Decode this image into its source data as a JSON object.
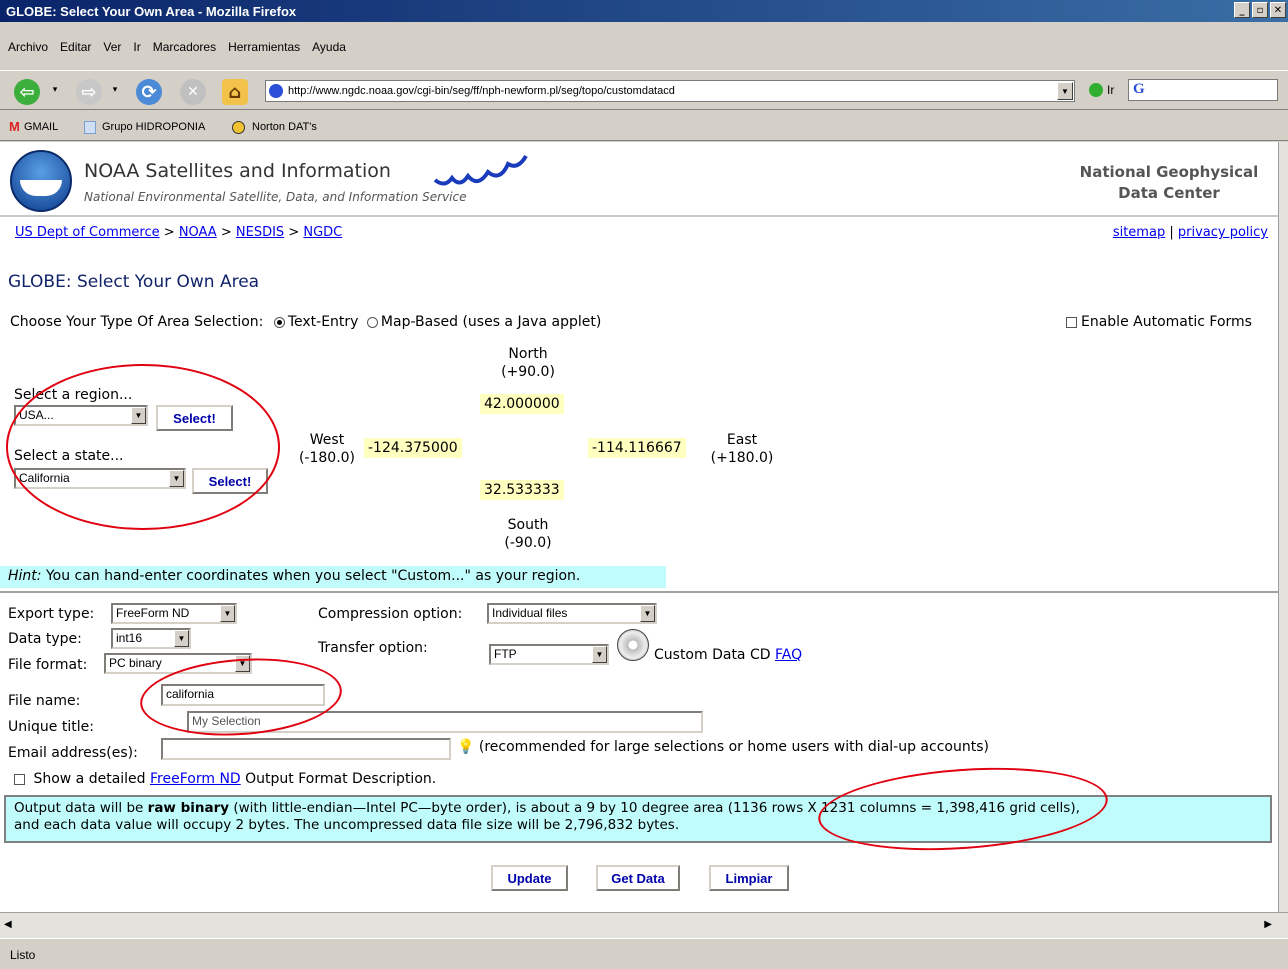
{
  "window": {
    "title": "GLOBE: Select Your Own Area - Mozilla Firefox"
  },
  "menu": [
    "Archivo",
    "Editar",
    "Ver",
    "Ir",
    "Marcadores",
    "Herramientas",
    "Ayuda"
  ],
  "nav": {
    "url": "http://www.ngdc.noaa.gov/cgi-bin/seg/ff/nph-newform.pl/seg/topo/customdatacd",
    "go_label": "Ir",
    "search_prefix": "G"
  },
  "bookmarks": [
    "GMAIL",
    "Grupo HIDROPONIA",
    "Norton DAT's"
  ],
  "header": {
    "title": "NOAA Satellites and Information",
    "subtitle": "National Environmental Satellite, Data, and Information Service",
    "center_line1": "National Geophysical",
    "center_line2": "Data Center"
  },
  "breadcrumb": {
    "items": [
      "US Dept of Commerce",
      "NOAA",
      "NESDIS",
      "NGDC"
    ],
    "sep": ">"
  },
  "toplinks": {
    "sitemap": "sitemap",
    "divider": "|",
    "privacy": "privacy policy"
  },
  "page_title": "GLOBE: Select Your Own Area",
  "area_type": {
    "label": "Choose Your Type Of Area Selection:",
    "text_entry": "Text-Entry",
    "map_based": "Map-Based (uses a Java applet)",
    "auto_forms": "Enable Automatic Forms"
  },
  "region": {
    "label": "Select a region...",
    "value": "USA...",
    "button": "Select!"
  },
  "state": {
    "label": "Select a state...",
    "value": "California",
    "button": "Select!"
  },
  "coords": {
    "north_label": "North",
    "north_range": "(+90.0)",
    "north_value": "42.000000",
    "west_label": "West",
    "west_range": "(-180.0)",
    "west_value": "-124.375000",
    "east_label": "East",
    "east_range": "(+180.0)",
    "east_value": "-114.116667",
    "south_label": "South",
    "south_range": "(-90.0)",
    "south_value": "32.533333"
  },
  "hint": {
    "label": "Hint:",
    "text": "You can hand-enter coordinates when you select \"Custom...\" as your region."
  },
  "form": {
    "export_label": "Export type:",
    "export_value": "FreeForm ND",
    "data_type_label": "Data type:",
    "data_type_value": "int16",
    "file_format_label": "File format:",
    "file_format_value": "PC binary",
    "file_name_label": "File name:",
    "file_name_value": "california",
    "unique_title_label": "Unique title:",
    "unique_title_value": "My Selection",
    "email_label": "Email address(es):",
    "email_value": "",
    "email_note": "(recommended for large selections or home users with dial-up accounts)",
    "compression_label": "Compression option:",
    "compression_value": "Individual files",
    "transfer_label": "Transfer option:",
    "transfer_value": "FTP",
    "cd_label": "Custom Data CD",
    "faq": "FAQ",
    "show_prefix": "Show a detailed",
    "show_link": "FreeForm ND",
    "show_suffix": "Output Format Description."
  },
  "output": {
    "p1": "Output data will be",
    "p_bold": "raw binary",
    "p2": "(with little-endian—Intel PC—byte order), is about a 9 by 10 degree area (1136 rows X 1231 columns = 1,398,416 grid cells),",
    "p3": "and each data value will occupy 2 bytes. The uncompressed data file size will be 2,796,832 bytes."
  },
  "buttons": {
    "update": "Update",
    "get_data": "Get Data",
    "clear": "Limpiar"
  },
  "status": "Listo",
  "colors": {
    "annotation": "#e00010",
    "highlight_cyan": "#c0fcfc",
    "coord_yellow": "#ffffc0"
  }
}
